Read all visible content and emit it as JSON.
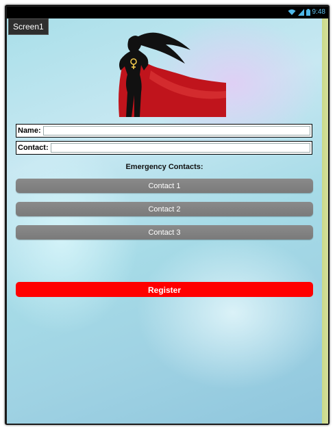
{
  "status_bar": {
    "time": "9:48",
    "icons": [
      "wifi-icon",
      "signal-icon",
      "battery-icon"
    ],
    "accent_color": "#4fb8e8"
  },
  "screen": {
    "title": "Screen1"
  },
  "logo": {
    "description_icon": "superhero-woman-logo",
    "cape_color": "#c0141c",
    "symbol_color": "#f2c94c"
  },
  "form": {
    "name_label": "Name:",
    "name_value": "",
    "contact_label": "Contact:",
    "contact_value": ""
  },
  "emergency": {
    "heading": "Emergency Contacts:",
    "buttons": [
      {
        "label": "Contact 1"
      },
      {
        "label": "Contact 2"
      },
      {
        "label": "Contact 3"
      }
    ]
  },
  "register": {
    "label": "Register",
    "color": "#ff0000"
  }
}
